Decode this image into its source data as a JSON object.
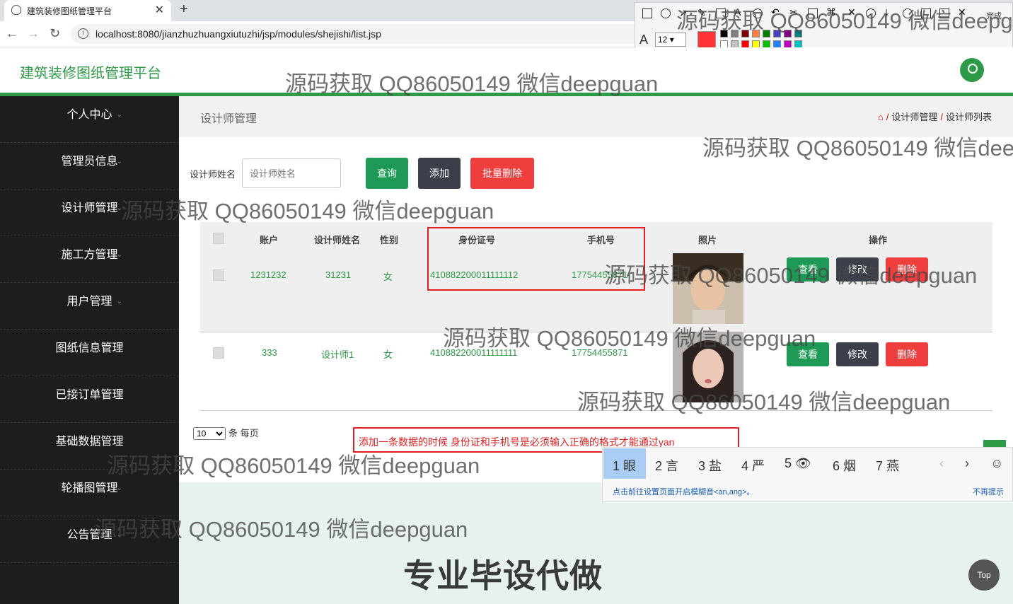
{
  "browser": {
    "tab_title": "建筑装修图纸管理平台",
    "url": "localhost:8080/jianzhuzhuangxiutuzhi/jsp/modules/shejishi/list.jsp"
  },
  "annotate": {
    "size": "12",
    "done_label": "完成",
    "current_color": "#ff3333",
    "swatches": [
      "#000000",
      "#808080",
      "#800000",
      "#ff8040",
      "#008000",
      "#4040c0",
      "#800080",
      "#008080",
      "#ffffff",
      "#c0c0c0",
      "#ff0000",
      "#ffff00",
      "#00c000",
      "#2080ff",
      "#c000c0",
      "#00c0c0"
    ]
  },
  "app": {
    "title": "建筑装修图纸管理平台",
    "accent": "#2d9a47"
  },
  "sidebar": {
    "items": [
      {
        "label": "个人中心"
      },
      {
        "label": "管理员信息"
      },
      {
        "label": "设计师管理"
      },
      {
        "label": "施工方管理"
      },
      {
        "label": "用户管理"
      },
      {
        "label": "图纸信息管理"
      },
      {
        "label": "已接订单管理"
      },
      {
        "label": "基础数据管理"
      },
      {
        "label": "轮播图管理"
      },
      {
        "label": "公告管理"
      }
    ]
  },
  "breadcrumb": {
    "page_title": "设计师管理",
    "trail": [
      "设计师管理",
      "设计师列表"
    ]
  },
  "search": {
    "label": "设计师姓名",
    "placeholder": "设计师姓名",
    "query_label": "查询",
    "add_label": "添加",
    "batch_delete_label": "批量删除"
  },
  "table": {
    "headers": [
      "账户",
      "设计师姓名",
      "性别",
      "身份证号",
      "手机号",
      "照片",
      "操作"
    ],
    "rows": [
      {
        "account": "1231232",
        "name": "31231",
        "gender": "女",
        "id_card": "410882200011111112",
        "phone": "17754455871"
      },
      {
        "account": "333",
        "name": "设计师1",
        "gender": "女",
        "id_card": "410882200011111111",
        "phone": "17754455871"
      }
    ],
    "view_label": "查看",
    "edit_label": "修改",
    "delete_label": "删除"
  },
  "pager": {
    "page_size": "10",
    "suffix": "条 每页"
  },
  "note": {
    "text": "添加一条数据的时候 身份证和手机号是必须输入正确的格式才能通过yan"
  },
  "ime": {
    "candidates": [
      "1 眼",
      "2 言",
      "3 盐",
      "4 严",
      "5 👁",
      "6 烟",
      "7 燕"
    ],
    "hint": "点击前往设置页面开启模糊音<an,ang>。",
    "dismiss": "不再提示"
  },
  "top_button": "Top",
  "watermarks": {
    "text": "源码获取 QQ86050149 微信deepguan",
    "banner": "专业毕设代做"
  }
}
